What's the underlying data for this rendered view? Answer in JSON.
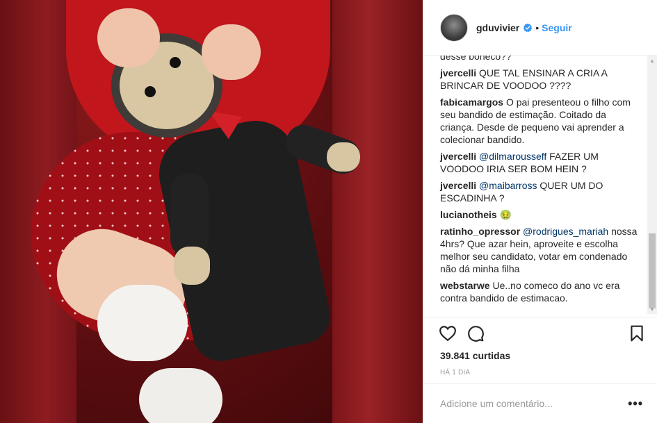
{
  "post": {
    "username": "gduvivier",
    "dot": "•",
    "follow_label": "Seguir"
  },
  "comments": [
    {
      "text": "desse boneco??"
    },
    {
      "user": "jvercelli",
      "text": "QUE TAL ENSINAR A CRIA A BRINCAR DE VOODOO ????"
    },
    {
      "user": "fabicamargos",
      "text": "O pai presenteou o filho com seu bandido de estimação. Coitado da criança. Desde de pequeno vai aprender a colecionar bandido."
    },
    {
      "user": "jvercelli",
      "mention": "@dilmarousseff",
      "text": "FAZER UM VOODOO IRIA SER BOM HEIN ?"
    },
    {
      "user": "jvercelli",
      "mention": "@maibarross",
      "text": "QUER UM DO ESCADINHA ?"
    },
    {
      "user": "lucianotheis",
      "text": "🤢"
    },
    {
      "user": "ratinho_opressor",
      "mention": "@rodrigues_mariah",
      "text": "nossa 4hrs? Que azar hein, aproveite e escolha melhor seu candidato, votar em condenado não dá minha filha"
    },
    {
      "user": "webstarwe",
      "text": "Ue..no comeco do ano vc era contra bandido de estimacao."
    }
  ],
  "likes": "39.841 curtidas",
  "time": "HÁ 1 DIA",
  "add_comment_placeholder": "Adicione um comentário...",
  "more_label": "•••",
  "icons": {
    "verified": "verified-badge-icon",
    "like": "heart-icon",
    "comment": "comment-bubble-icon",
    "bookmark": "bookmark-icon",
    "scroll_up": "scroll-up-arrow-icon",
    "scroll_down": "scroll-down-arrow-icon"
  },
  "colors": {
    "link": "#3897f0",
    "text": "#262626",
    "muted": "#999999",
    "mention": "#003569"
  }
}
